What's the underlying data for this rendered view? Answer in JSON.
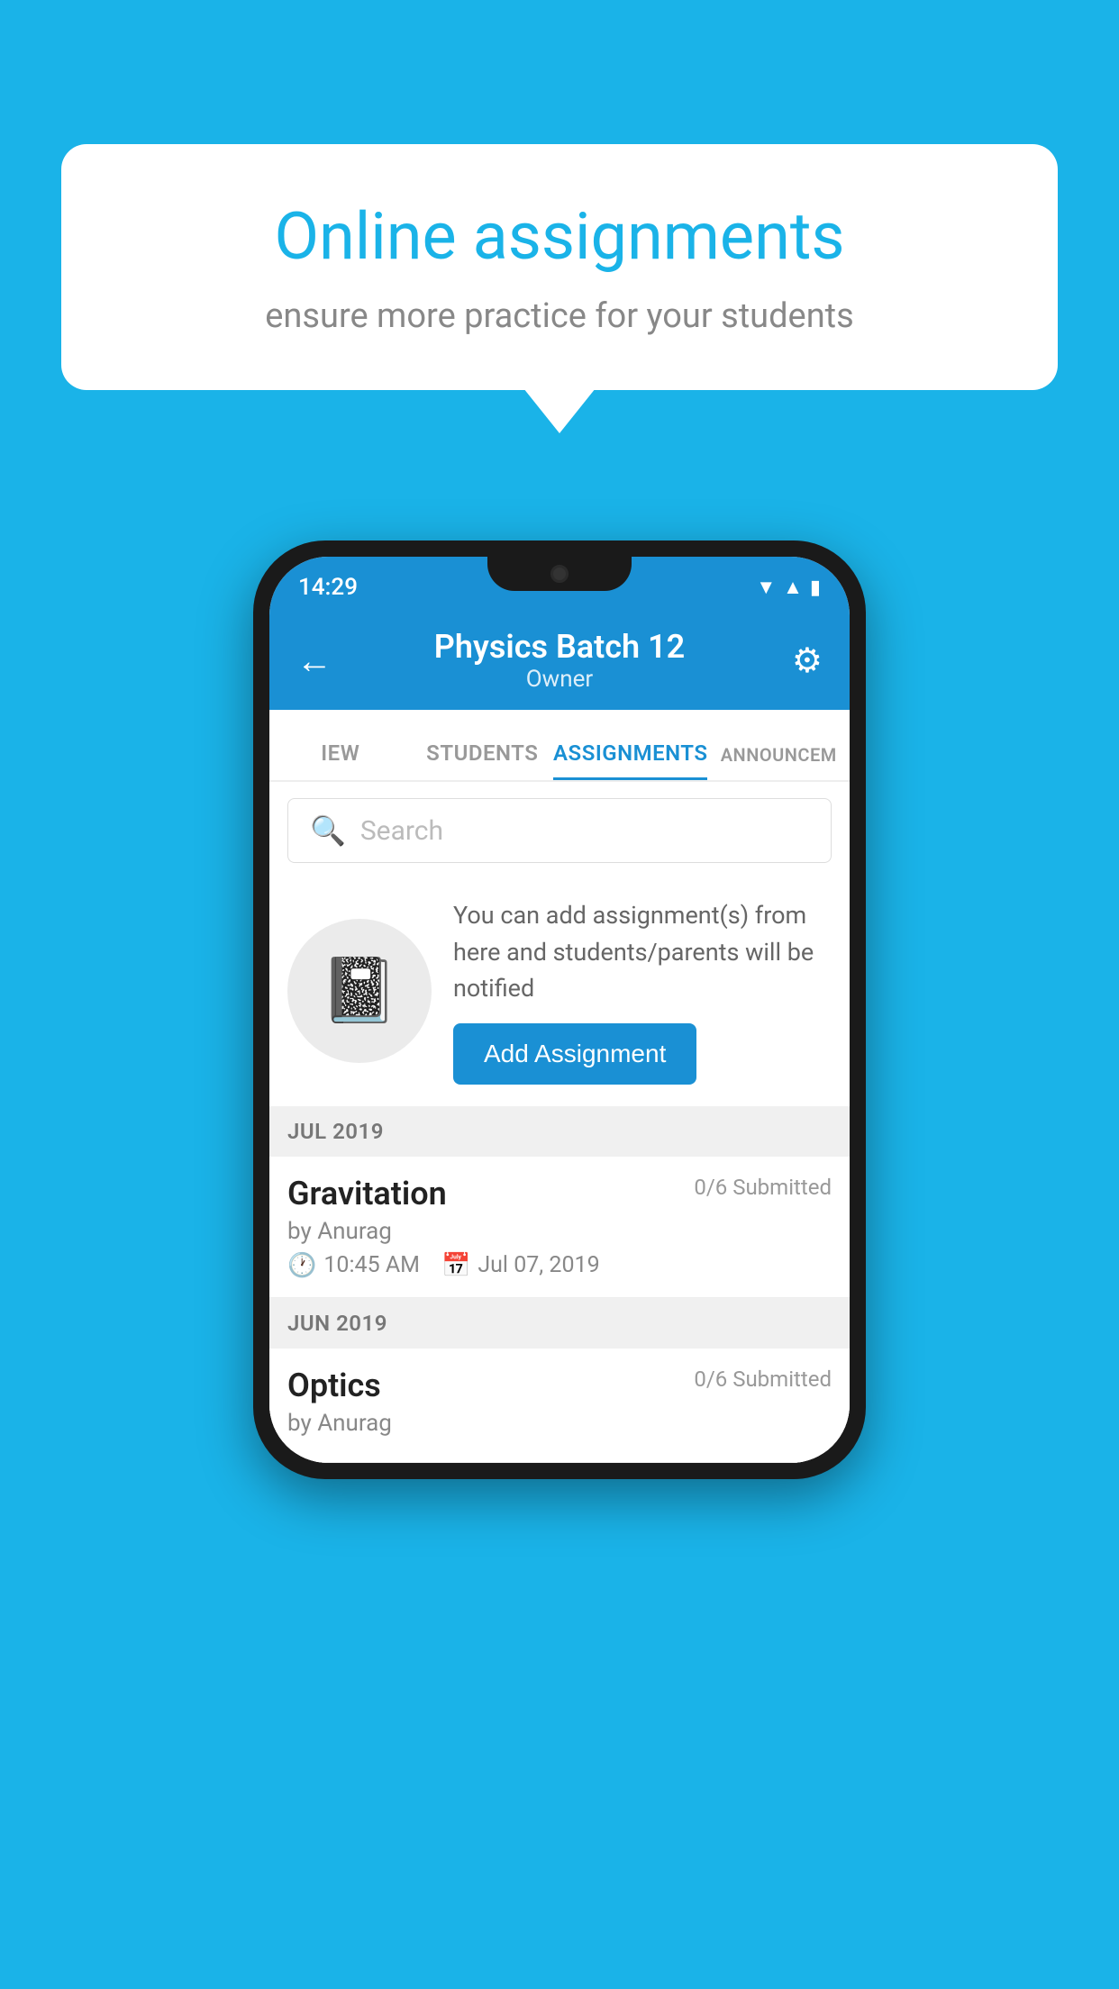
{
  "background_color": "#1ab3e8",
  "speech_bubble": {
    "title": "Online assignments",
    "subtitle": "ensure more practice for your students"
  },
  "phone": {
    "status_bar": {
      "time": "14:29",
      "icons": [
        "wifi",
        "signal",
        "battery"
      ]
    },
    "header": {
      "title": "Physics Batch 12",
      "subtitle": "Owner",
      "back_label": "←",
      "gear_label": "⚙"
    },
    "tabs": [
      {
        "label": "IEW",
        "active": false
      },
      {
        "label": "STUDENTS",
        "active": false
      },
      {
        "label": "ASSIGNMENTS",
        "active": true
      },
      {
        "label": "ANNOUNCEM",
        "active": false
      }
    ],
    "search": {
      "placeholder": "Search"
    },
    "info": {
      "description": "You can add assignment(s) from here and students/parents will be notified",
      "add_button_label": "Add Assignment"
    },
    "sections": [
      {
        "label": "JUL 2019",
        "assignments": [
          {
            "title": "Gravitation",
            "submitted": "0/6 Submitted",
            "author": "by Anurag",
            "time": "10:45 AM",
            "date": "Jul 07, 2019"
          }
        ]
      },
      {
        "label": "JUN 2019",
        "assignments": [
          {
            "title": "Optics",
            "submitted": "0/6 Submitted",
            "author": "by Anurag",
            "time": "",
            "date": ""
          }
        ]
      }
    ]
  }
}
